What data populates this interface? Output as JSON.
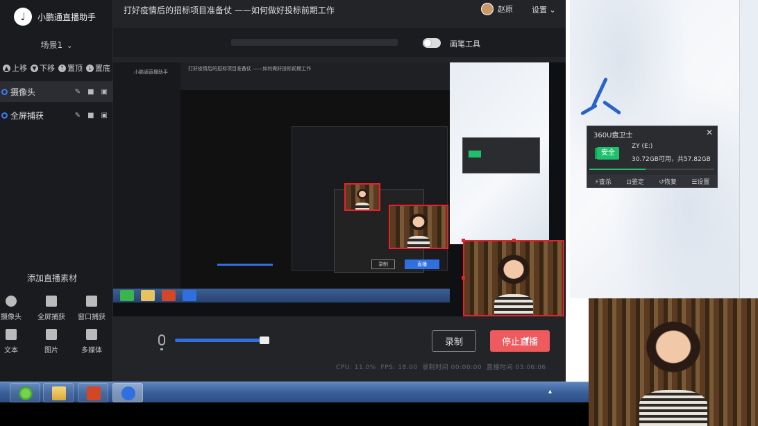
{
  "app": {
    "name": "小鹏通直播助手",
    "scene_label": "场景1",
    "window_title": "打好疫情后的招标项目准备仗 ——如何做好投标前期工作",
    "user_name": "赵原",
    "settings_label": "设置",
    "pen_tool_label": "画笔工具"
  },
  "sidebar": {
    "controls": [
      "上移",
      "下移",
      "置顶",
      "置底"
    ],
    "sources": [
      {
        "label": "摄像头",
        "active": true
      },
      {
        "label": "全屏捕获",
        "active": false
      }
    ],
    "add_title": "添加直播素材",
    "add_items": [
      {
        "label": "摄像头",
        "icon": "camera-icon"
      },
      {
        "label": "全屏捕获",
        "icon": "monitor-icon"
      },
      {
        "label": "窗口捕获",
        "icon": "window-icon"
      },
      {
        "label": "文本",
        "icon": "document-icon"
      },
      {
        "label": "图片",
        "icon": "image-icon"
      },
      {
        "label": "多媒体",
        "icon": "media-icon"
      }
    ]
  },
  "controls": {
    "record_label": "录制",
    "stop_live_label": "停止直播",
    "volume_fraction": 0.92,
    "stats": {
      "cpu_label": "CPU:",
      "cpu_value": "11.0%",
      "fps_label": "FPS:",
      "fps_value": "18.00",
      "record_time_label": "录制时间",
      "record_time": "00:00:00",
      "live_time_label": "直播时间",
      "live_time": "03:06:06"
    }
  },
  "desktop_popup": {
    "title": "360U盘卫士",
    "close": "✕",
    "status": "安全",
    "drive_name": "ZY (E:)",
    "drive_info": "30.72GB可用，共57.82GB",
    "progress_fraction": 0.45,
    "actions": [
      "查杀",
      "鉴定",
      "恢复",
      "设置"
    ]
  },
  "nested": {
    "title_small": "打好疫情后的招标项目准备仗 ——如何做好投标前期工作",
    "record": "录制",
    "stop": "直播"
  },
  "colors": {
    "accent_blue": "#2f6fe0",
    "stop_red": "#ef5a5e",
    "safe_green": "#1fc06b",
    "selection_red": "#e8202a"
  }
}
